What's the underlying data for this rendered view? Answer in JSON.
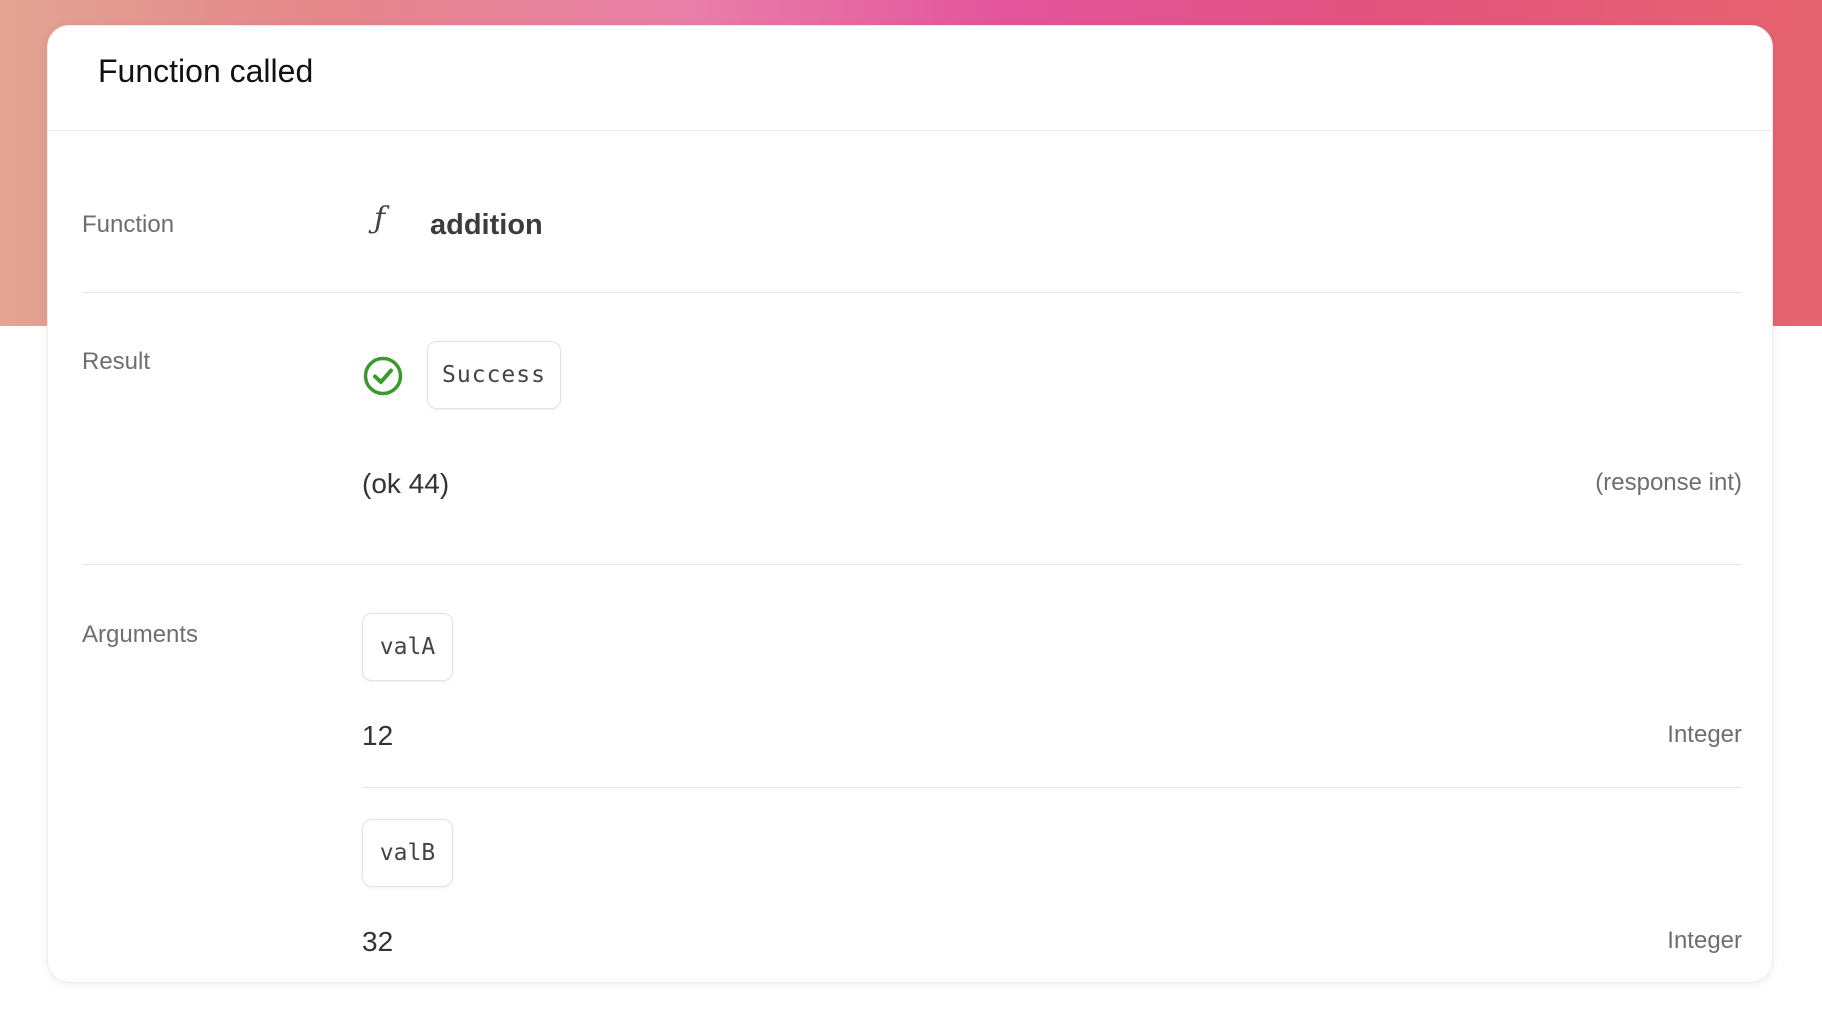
{
  "card": {
    "title": "Function called"
  },
  "function_row": {
    "label": "Function",
    "icon_glyph": "ƒ",
    "icon": "function-icon",
    "name": "addition"
  },
  "result_row": {
    "label": "Result",
    "status_icon": "check-circle-icon",
    "status_color": "#3b9a2e",
    "status": "Success",
    "value": "(ok 44)",
    "type": "(response int)"
  },
  "arguments_row": {
    "label": "Arguments",
    "items": [
      {
        "name": "valA",
        "value": "12",
        "type": "Integer"
      },
      {
        "name": "valB",
        "value": "32",
        "type": "Integer"
      }
    ]
  },
  "colors": {
    "banner_gradient": [
      "#e2a493",
      "#e87fa8",
      "#e3559b",
      "#e66470"
    ],
    "card_background": "#ffffff"
  }
}
